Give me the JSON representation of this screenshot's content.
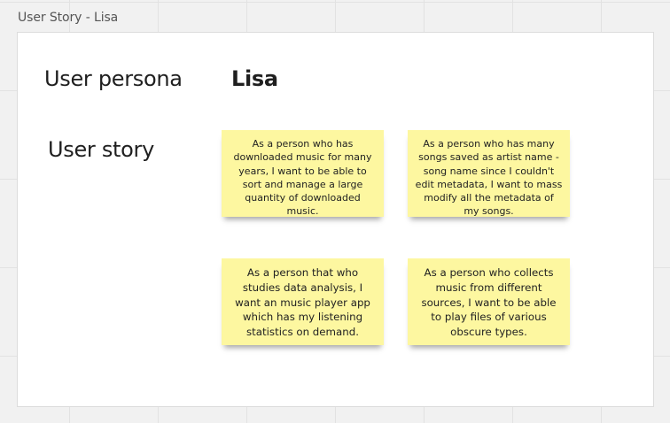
{
  "frame": {
    "title": "User Story - Lisa"
  },
  "persona": {
    "label": "User persona",
    "name": "Lisa"
  },
  "story": {
    "label": "User story",
    "stickies": [
      "As a person who has downloaded music for many years, I want to be able to sort and manage a large quantity of downloaded music.",
      "As a person who has many songs saved as artist name - song name since I couldn't edit metadata, I want to mass modify all the metadata of my songs.",
      "As a person that who studies data analysis, I want an music player app which has my listening statistics on demand.",
      "As a person who collects music from different sources, I want to be able to play files of various obscure types."
    ]
  },
  "colors": {
    "sticky": "#fdf7a0",
    "board": "#f1f1f1",
    "frame": "#ffffff"
  }
}
